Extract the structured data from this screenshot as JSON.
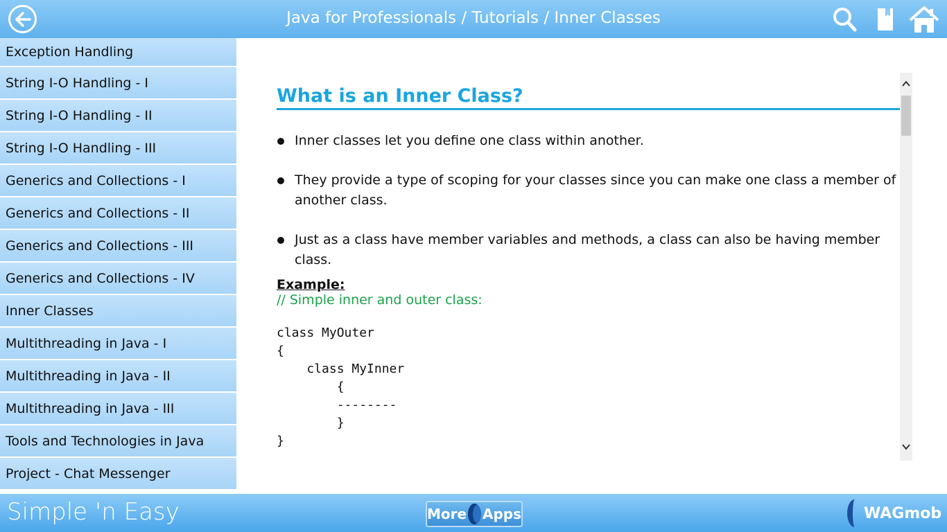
{
  "header": {
    "title": "Java for Professionals / Tutorials / Inner Classes",
    "back_icon": "back-arrow-icon",
    "search_icon": "search-icon",
    "bookmark_icon": "bookmark-icon",
    "home_icon": "home-icon",
    "color": "#5fb2ee"
  },
  "sidebar": {
    "items": [
      {
        "label": "Exception Handling"
      },
      {
        "label": "String I-O Handling - I"
      },
      {
        "label": "String I-O Handling - II"
      },
      {
        "label": "String I-O Handling - III"
      },
      {
        "label": "Generics and Collections - I"
      },
      {
        "label": "Generics and Collections - II"
      },
      {
        "label": "Generics and Collections - III"
      },
      {
        "label": "Generics and Collections - IV"
      },
      {
        "label": "Inner Classes"
      },
      {
        "label": "Multithreading in Java - I"
      },
      {
        "label": "Multithreading in Java - II"
      },
      {
        "label": "Multithreading in Java - III"
      },
      {
        "label": "Tools and Technologies in Java"
      },
      {
        "label": "Project - Chat Messenger"
      }
    ]
  },
  "article": {
    "heading": "What is an Inner Class?",
    "bullets": [
      "Inner classes let you define one class within another.",
      "They provide a type of scoping for your classes since you can make one class a member of another class.",
      "Just as a class have member variables and methods, a class can also be having member class."
    ],
    "example_label": "Example:",
    "comment": "// Simple inner and outer class:",
    "code": "class MyOuter\n{\n    class MyInner\n        {\n        --------\n        }\n}",
    "heading_color": "#1aa5e0",
    "comment_color": "#19a348"
  },
  "footer": {
    "brand": "Simple 'n Easy",
    "more_label": "More",
    "apps_label": "Apps",
    "logo_text": "WAGmob"
  }
}
